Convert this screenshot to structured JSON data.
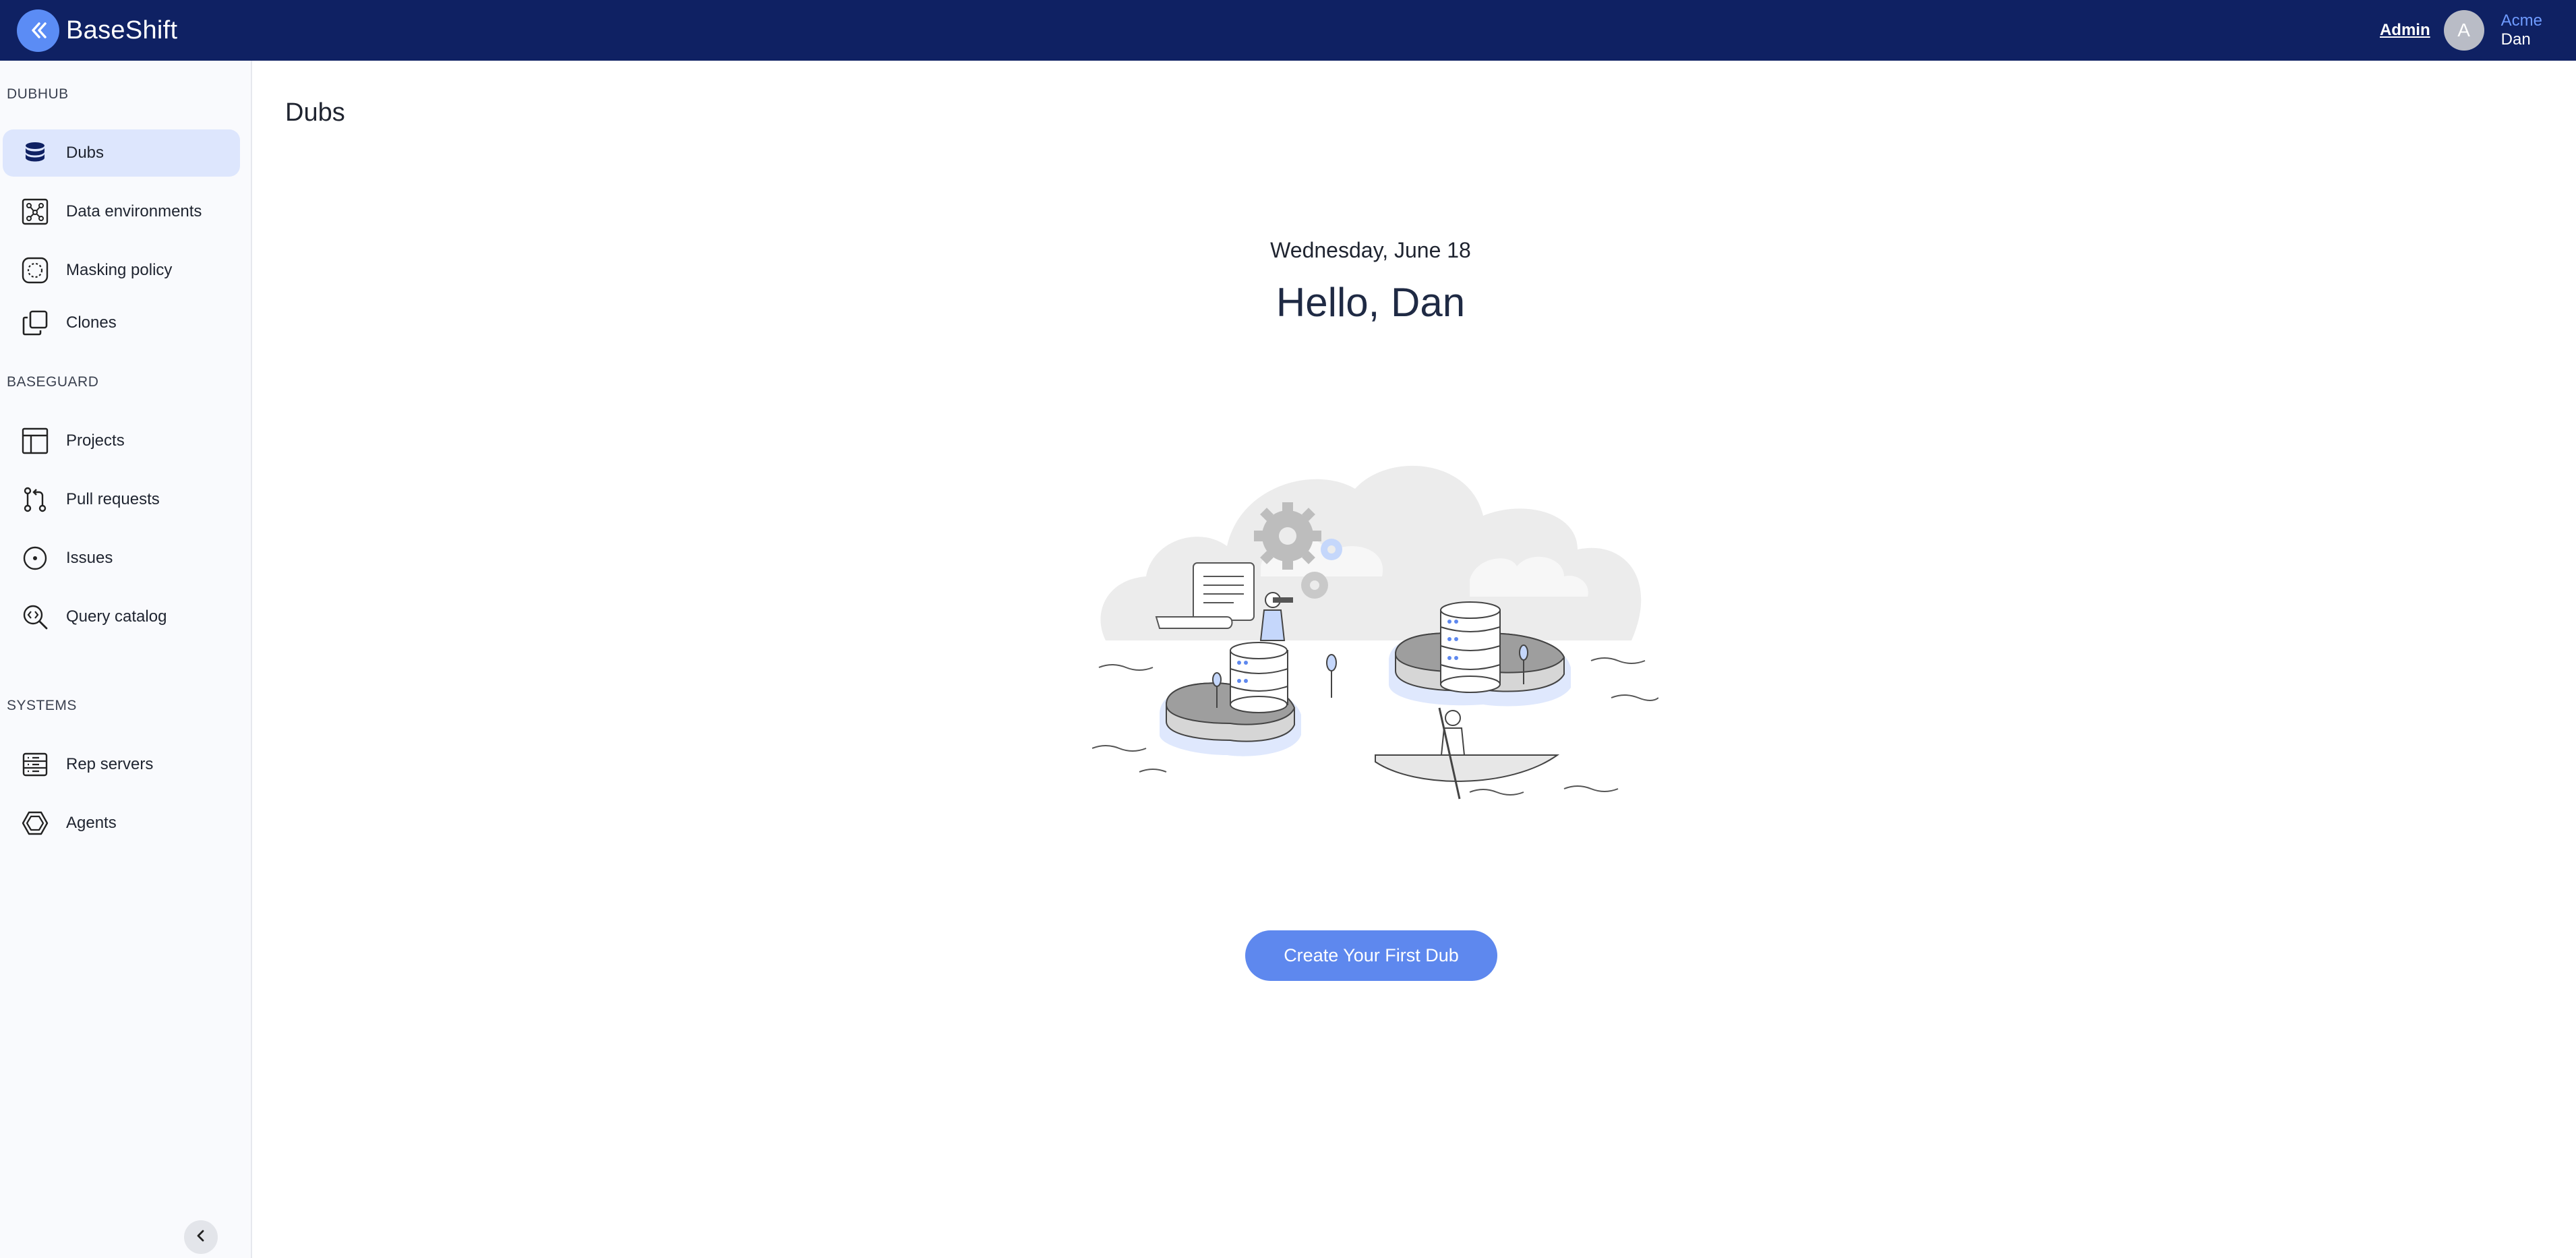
{
  "app": {
    "brand_name": "BaseShift",
    "admin_label": "Admin",
    "avatar_initial": "A",
    "org_name": "Acme",
    "user_name": "Dan"
  },
  "sidebar": {
    "sections": [
      {
        "label": "DUBHUB",
        "items": [
          {
            "label": "Dubs",
            "icon": "database-icon",
            "active": true
          },
          {
            "label": "Data environments",
            "icon": "network-icon"
          },
          {
            "label": "Masking policy",
            "icon": "dashed-circle-icon"
          },
          {
            "label": "Clones",
            "icon": "copy-icon"
          }
        ]
      },
      {
        "label": "BASEGUARD",
        "items": [
          {
            "label": "Projects",
            "icon": "table-layout-icon"
          },
          {
            "label": "Pull requests",
            "icon": "pull-request-icon"
          },
          {
            "label": "Issues",
            "icon": "issue-icon"
          },
          {
            "label": "Query catalog",
            "icon": "search-code-icon"
          }
        ]
      },
      {
        "label": "SYSTEMS",
        "items": [
          {
            "label": "Rep servers",
            "icon": "server-icon"
          },
          {
            "label": "Agents",
            "icon": "hexagon-icon"
          }
        ]
      }
    ],
    "collapse_icon": "chevron-left-icon"
  },
  "main": {
    "page_title": "Dubs",
    "date": "Wednesday, June 18",
    "greeting": "Hello, Dan",
    "cta_label": "Create Your First Dub"
  },
  "colors": {
    "topbar": "#0f2163",
    "accent": "#5e88ee",
    "active_nav": "#dde6fd",
    "org_text": "#6f9bff"
  }
}
